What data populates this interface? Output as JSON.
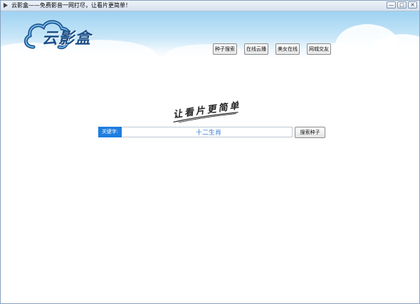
{
  "window": {
    "title": "云影盒——免费影音一网打尽，让看片更简单！",
    "controls": {
      "minimize": "—",
      "maximize": "□",
      "close": "✕"
    }
  },
  "banner": {
    "logo_text": "云影盒",
    "nav": [
      {
        "label": "种子搜索"
      },
      {
        "label": "在线云播"
      },
      {
        "label": "美女在线"
      },
      {
        "label": "网城交友"
      }
    ]
  },
  "main": {
    "slogan": "让看片更简单",
    "search": {
      "label": "关键字:",
      "value": "十二生肖",
      "button_label": "搜索种子"
    }
  },
  "colors": {
    "accent": "#1e7de0",
    "banner_sky": "#9ed2f2",
    "logo_text": "#1b4e86"
  }
}
